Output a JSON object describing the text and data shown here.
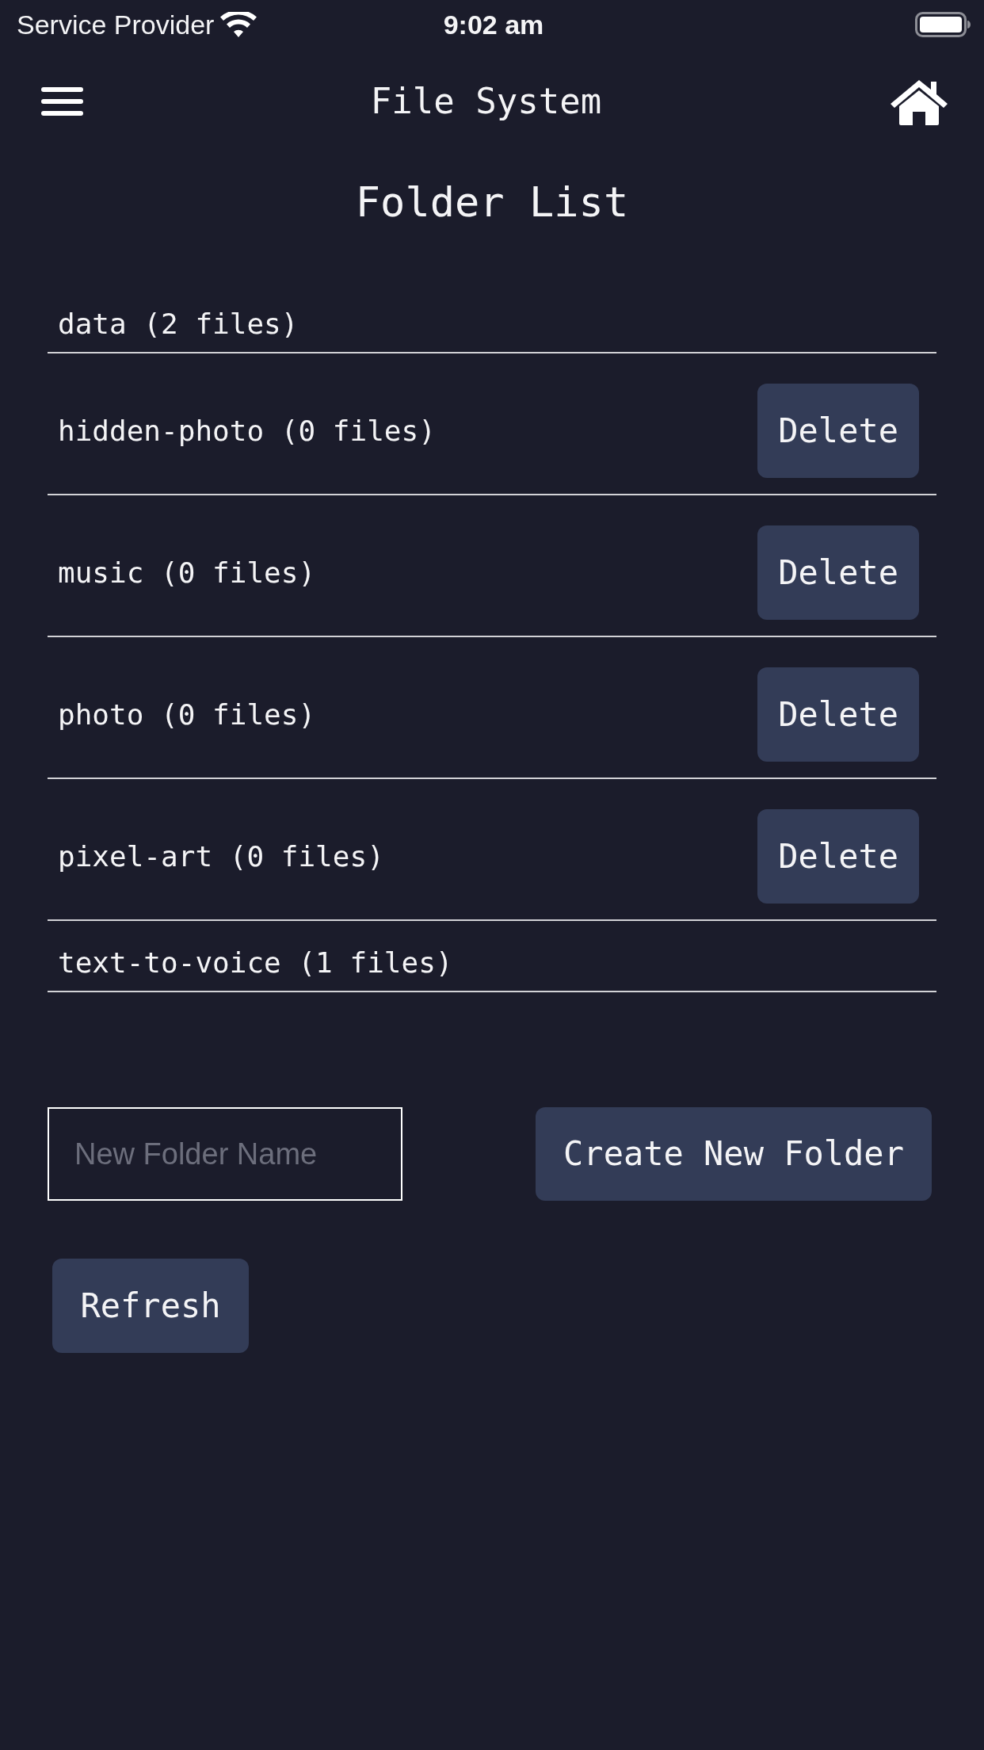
{
  "status_bar": {
    "carrier": "Service Provider",
    "time": "9:02 am"
  },
  "header": {
    "title": "File System"
  },
  "heading": "Folder List",
  "folders": [
    {
      "label": "data (2 files)"
    },
    {
      "label": "hidden-photo (0 files)",
      "action": "Delete"
    },
    {
      "label": "music (0 files)",
      "action": "Delete"
    },
    {
      "label": "photo (0 files)",
      "action": "Delete"
    },
    {
      "label": "pixel-art (0 files)",
      "action": "Delete"
    },
    {
      "label": "text-to-voice (1 files)"
    }
  ],
  "new_folder": {
    "placeholder": "New Folder Name",
    "button": "Create New Folder"
  },
  "buttons": [
    "Refresh"
  ]
}
